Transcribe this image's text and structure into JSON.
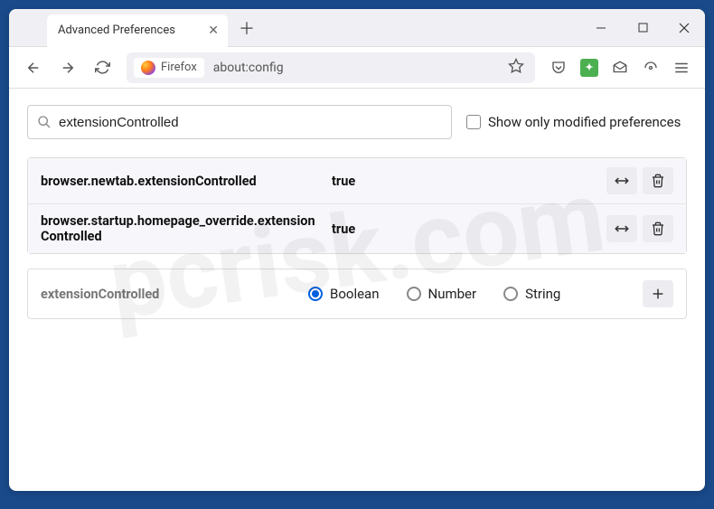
{
  "window": {
    "tab_title": "Advanced Preferences"
  },
  "toolbar": {
    "identity_label": "Firefox",
    "url": "about:config"
  },
  "search": {
    "value": "extensionControlled",
    "show_modified_label": "Show only modified preferences"
  },
  "prefs": [
    {
      "name": "browser.newtab.extensionControlled",
      "value": "true"
    },
    {
      "name": "browser.startup.homepage_override.extensionControlled",
      "value": "true"
    }
  ],
  "add": {
    "name": "extensionControlled",
    "types": {
      "boolean": "Boolean",
      "number": "Number",
      "string": "String"
    }
  },
  "watermark": "pcrisk.com"
}
